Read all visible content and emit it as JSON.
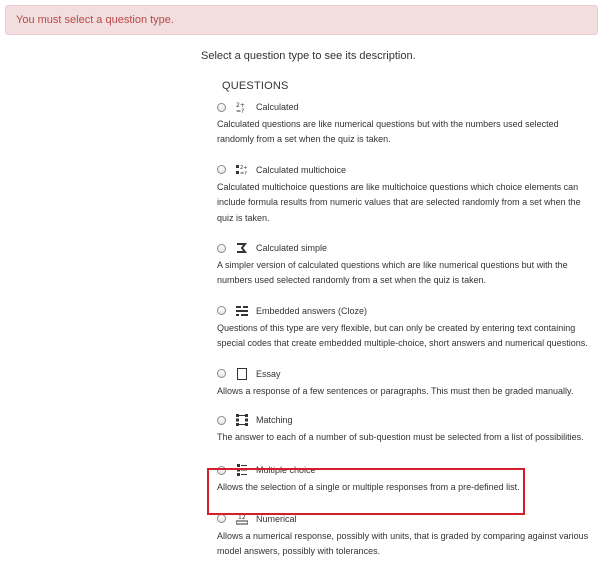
{
  "alert": {
    "text": "You must select a question type."
  },
  "instruction": "Select a question type to see its description.",
  "section_title": "QUESTIONS",
  "questions": [
    {
      "name": "Calculated",
      "icon": "calculated-icon",
      "desc": "Calculated questions are like numerical questions but with the numbers used selected randomly from a set when the quiz is taken."
    },
    {
      "name": "Calculated multichoice",
      "icon": "calculated-multichoice-icon",
      "desc": "Calculated multichoice questions are like multichoice questions which choice elements can include formula results from numeric values that are selected randomly from a set when the quiz is taken."
    },
    {
      "name": "Calculated simple",
      "icon": "calculated-simple-icon",
      "desc": "A simpler version of calculated questions which are like numerical questions but with the numbers used selected randomly from a set when the quiz is taken."
    },
    {
      "name": "Embedded answers (Cloze)",
      "icon": "cloze-icon",
      "desc": "Questions of this type are very flexible, but can only be created by entering text containing special codes that create embedded multiple-choice, short answers and numerical questions."
    },
    {
      "name": "Essay",
      "icon": "essay-icon",
      "desc": "Allows a response of a few sentences or paragraphs. This must then be graded manually."
    },
    {
      "name": "Matching",
      "icon": "matching-icon",
      "desc": "The answer to each of a number of sub-question must be selected from a list of possibilities."
    },
    {
      "name": "Multiple choice",
      "icon": "multiple-choice-icon",
      "desc": "Allows the selection of a single or multiple responses from a pre-defined list."
    },
    {
      "name": "Numerical",
      "icon": "numerical-icon",
      "desc": "Allows a numerical response, possibly with units, that is graded by comparing against various model answers, possibly with tolerances."
    }
  ],
  "colors": {
    "highlight": "#d31f2a",
    "alert_bg": "#f2dede",
    "alert_text": "#b94a48"
  }
}
